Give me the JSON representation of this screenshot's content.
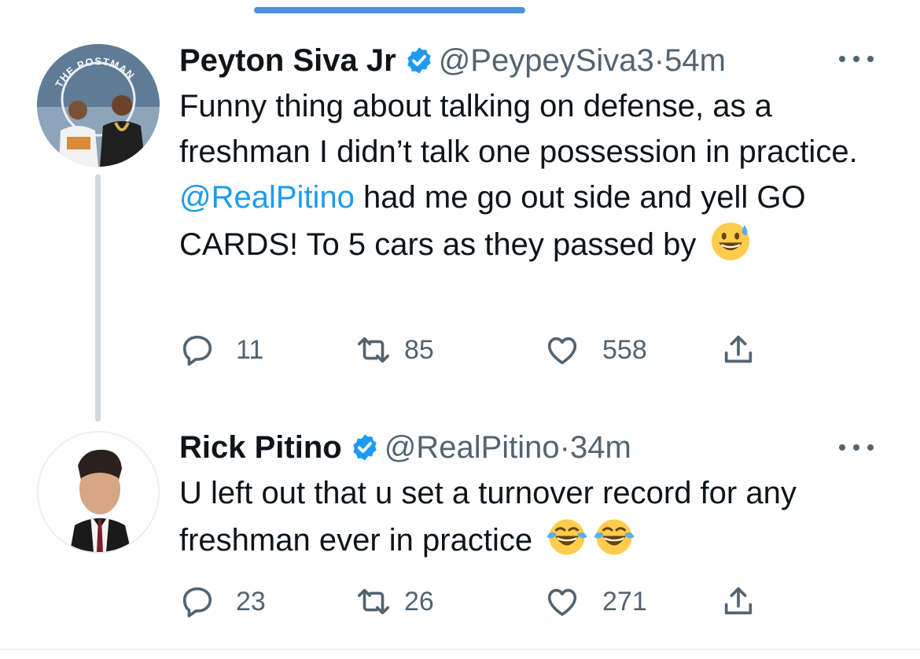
{
  "tweets": [
    {
      "name": "Peyton Siva Jr",
      "handle": "@PeypeySiva3",
      "separator": "·",
      "time": "54m",
      "verified": true,
      "avatar_text": "THE POSTMAN",
      "text_parts": [
        "Funny thing about talking on defense, as a freshman I didn’t talk one possession in practice. ",
        "@RealPitino",
        " had me go out side and yell GO CARDS! To 5 cars as they passed by "
      ],
      "emoji": [
        "grinning-face-with-sweat"
      ],
      "replies": "11",
      "retweets": "85",
      "likes": "558"
    },
    {
      "name": "Rick Pitino",
      "handle": "@RealPitino",
      "separator": "·",
      "time": "34m",
      "verified": true,
      "text": "U left out that u set a turnover record for any freshman ever in practice ",
      "emoji": [
        "face-with-tears-of-joy",
        "face-with-tears-of-joy"
      ],
      "replies": "23",
      "retweets": "26",
      "likes": "271"
    }
  ],
  "colors": {
    "accent": "#1d9bf0",
    "text": "#0f1419",
    "muted": "#536471",
    "thread_line": "#cfd9de",
    "scroll_indicator": "#4a8fe0"
  }
}
